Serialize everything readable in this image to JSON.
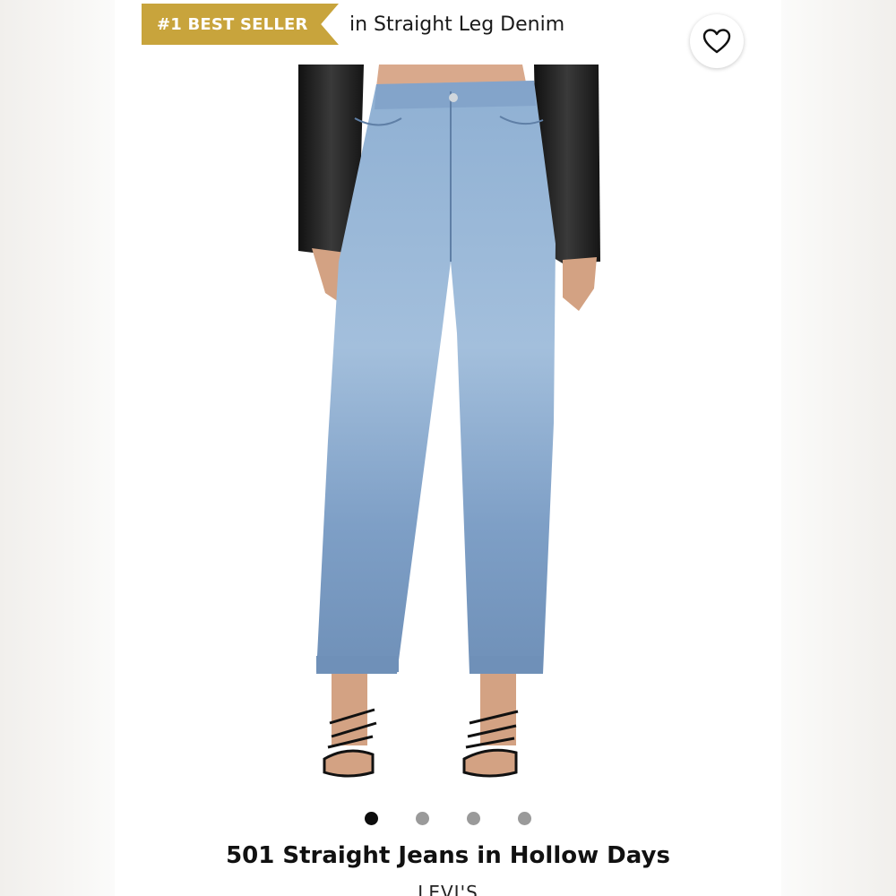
{
  "badge": {
    "label": "#1 BEST SELLER",
    "context": "in Straight Leg Denim",
    "color": "#c8a43c"
  },
  "favorite": {
    "icon": "heart-outline-icon"
  },
  "product": {
    "title": "501 Straight Jeans in Hollow Days",
    "brand": "LEVI'S",
    "image_description_icon": "jeans-photo"
  },
  "carousel": {
    "total": 4,
    "active_index": 1
  }
}
